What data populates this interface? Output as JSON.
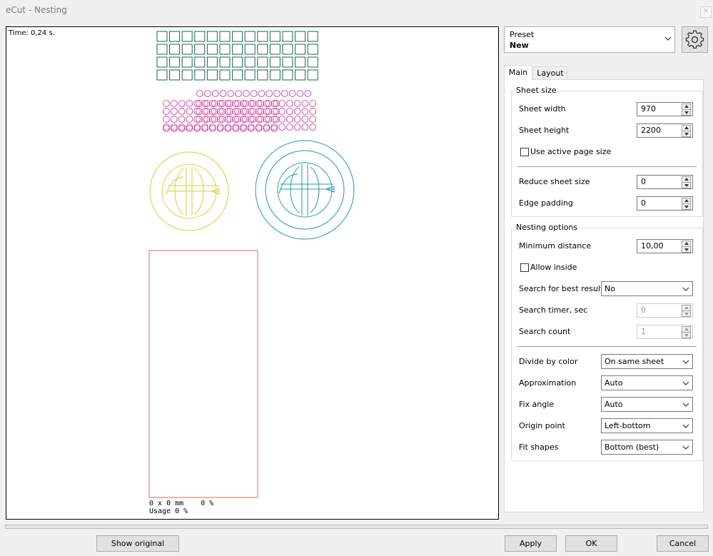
{
  "window": {
    "title": "eCut - Nesting"
  },
  "preview": {
    "time": "Time: 0,24 s.",
    "sheet_info": "0 x 0 mm    0 %",
    "usage": "Usage 0 %",
    "colors": {
      "squares": "#17664f",
      "circles": "#d1208f",
      "yellow": "#d6d231",
      "teal": "#1f9bb3",
      "sheet": "#e06767"
    }
  },
  "preset": {
    "label": "Preset",
    "value": "New"
  },
  "tabs": {
    "main": "Main",
    "layout": "Layout"
  },
  "sheet_size": {
    "title": "Sheet size",
    "sheet_width_label": "Sheet width",
    "sheet_width": "970",
    "sheet_height_label": "Sheet height",
    "sheet_height": "2200",
    "use_active_page_size": "Use active page size",
    "reduce_sheet_size_label": "Reduce sheet size",
    "reduce_sheet_size": "0",
    "edge_padding_label": "Edge padding",
    "edge_padding": "0"
  },
  "nesting_options": {
    "title": "Nesting options",
    "minimum_distance_label": "Minimum distance",
    "minimum_distance": "10,00",
    "allow_inside": "Allow inside",
    "search_best_label": "Search for best result",
    "search_best": "No",
    "search_timer_label": "Search timer, sec",
    "search_timer": "0",
    "search_count_label": "Search count",
    "search_count": "1",
    "divide_by_color_label": "Divide by color",
    "divide_by_color": "On same sheet",
    "approximation_label": "Approximation",
    "approximation": "Auto",
    "fix_angle_label": "Fix angle",
    "fix_angle": "Auto",
    "origin_point_label": "Origin point",
    "origin_point": "Left-bottom",
    "fit_shapes_label": "Fit shapes",
    "fit_shapes": "Bottom (best)"
  },
  "buttons": {
    "show_original": "Show original",
    "apply": "Apply",
    "ok": "OK",
    "cancel": "Cancel"
  }
}
